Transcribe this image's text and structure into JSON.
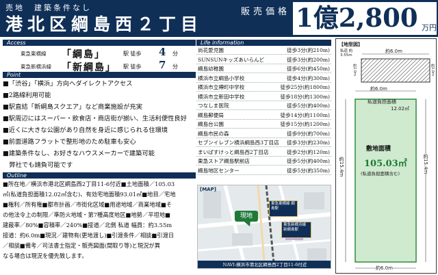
{
  "header": {
    "tags": "売地　建築条件なし",
    "title": "港北区綱島西２丁目",
    "price_label": "販売価格",
    "price": "1億2,800",
    "price_unit": "万円"
  },
  "access": {
    "section_label": "Access",
    "lines": [
      {
        "line": "東急東横線",
        "station": "「綱島」",
        "walk_label": "駅 徒歩",
        "minutes": "4",
        "unit": "分"
      },
      {
        "line": "東急新横浜線",
        "station": "「新綱島」",
        "walk_label": "駅 徒歩",
        "minutes": "7",
        "unit": "分"
      }
    ]
  },
  "point": {
    "section_label": "Point",
    "items": [
      "■「渋谷」「横浜」方向へダイレクトアクセス",
      "■2路線利用可能",
      "■駅直結「新綱島スクエア」など商業施設が充実",
      "■駅周辺にはスーパー・飲食店・商店街が揃い、生活利便性良好",
      "■近くに大きな公園があり自然を身近に感じられる住環境",
      "■前面道路フラットで整形地のため駐車も安心",
      "■建築条件なし、お好きなハウスメーカーで建築可能",
      "　弊社でも請負可能です"
    ]
  },
  "outline": {
    "section_label": "Outline",
    "lines": [
      "■所在地／横浜市港北区綱島西2丁目11-6付近■土地面積／105.03",
      "㎡(私道負担面積12.02㎡含む)、有効宅地面積93.01㎡■地目／宅地",
      "■権利／所有権■都市計画／市街化区域■用途地域／商業地域■そ",
      "の他法令上の制限／準防火地域・第7種高度地区■地勢／平坦地■",
      "建蔽率／80%■容積率／240%■接道／北側 私道 幅員：約3.55m",
      "接道：約6.0m■現況／建物有(更地渡し)■引渡条件／相談■引渡日",
      "／相談■備考／司法書士指定・販売図面(間取り等)と現況が異",
      "なる場合は現況を優先致します。"
    ]
  },
  "life": {
    "section_label": "Life information",
    "rows": [
      {
        "name": "尚花愛児園",
        "dist": "徒歩3分(約210m)"
      },
      {
        "name": "SUNSUNキッズあいらんど",
        "dist": "徒歩3分(約200m)"
      },
      {
        "name": "綱島幼稚園",
        "dist": "徒歩6分(約450m)"
      },
      {
        "name": "横浜市立綱島小学校",
        "dist": "徒歩4分(約300m)"
      },
      {
        "name": "横浜市立樽町中学校",
        "dist": "徒歩25分(約1800m)"
      },
      {
        "name": "横浜市立新田中学校",
        "dist": "徒歩18分(約1300m)"
      },
      {
        "name": "つなしま医院",
        "dist": "徒歩5分(約400m)"
      },
      {
        "name": "綱島郵便局",
        "dist": "徒歩14分(約1100m)"
      },
      {
        "name": "綱島台公園",
        "dist": "徒歩15分(約1200m)"
      },
      {
        "name": "綱島市民の森",
        "dist": "徒歩9分(約700m)"
      },
      {
        "name": "セブンイレブン横浜綱島西3丁目店",
        "dist": "徒歩3分(約230m)"
      },
      {
        "name": "まいばすけっと綱島西2丁目店",
        "dist": "徒歩2分(約120m)"
      },
      {
        "name": "東急ストア綱島駅前店",
        "dist": "徒歩5分(約400m)"
      },
      {
        "name": "綱島地区センター",
        "dist": "徒歩5分(約350m)"
      }
    ]
  },
  "map": {
    "label": "[MAP]",
    "site_label": "現地",
    "station1": "東急東横線 綱島駅",
    "station2": "東急新横浜線 新綱島駅",
    "navi": "NAVI:横浜市港北区綱島西2丁目11-6付近"
  },
  "plan": {
    "label": "【地型図】",
    "private_road": "私道 約3.55m",
    "top_width": "約6.0m",
    "left_small": "約2.0m",
    "right_small": "約2.0m",
    "inner_width": "約6.0m",
    "road_area_label": "私道負担面積",
    "road_area": "12.02㎡",
    "area_title": "敷地面積",
    "area_value": "105.03㎡",
    "area_note": "(私道負担面積含む)",
    "left_len": "約15.4m",
    "right_len": "約15.4m",
    "bottom_width": "約6.0m"
  },
  "colors": {
    "navy": "#0f2f57",
    "land": "#cfeacf",
    "land_border": "#2e8b3a",
    "value": "#1a7a30"
  }
}
